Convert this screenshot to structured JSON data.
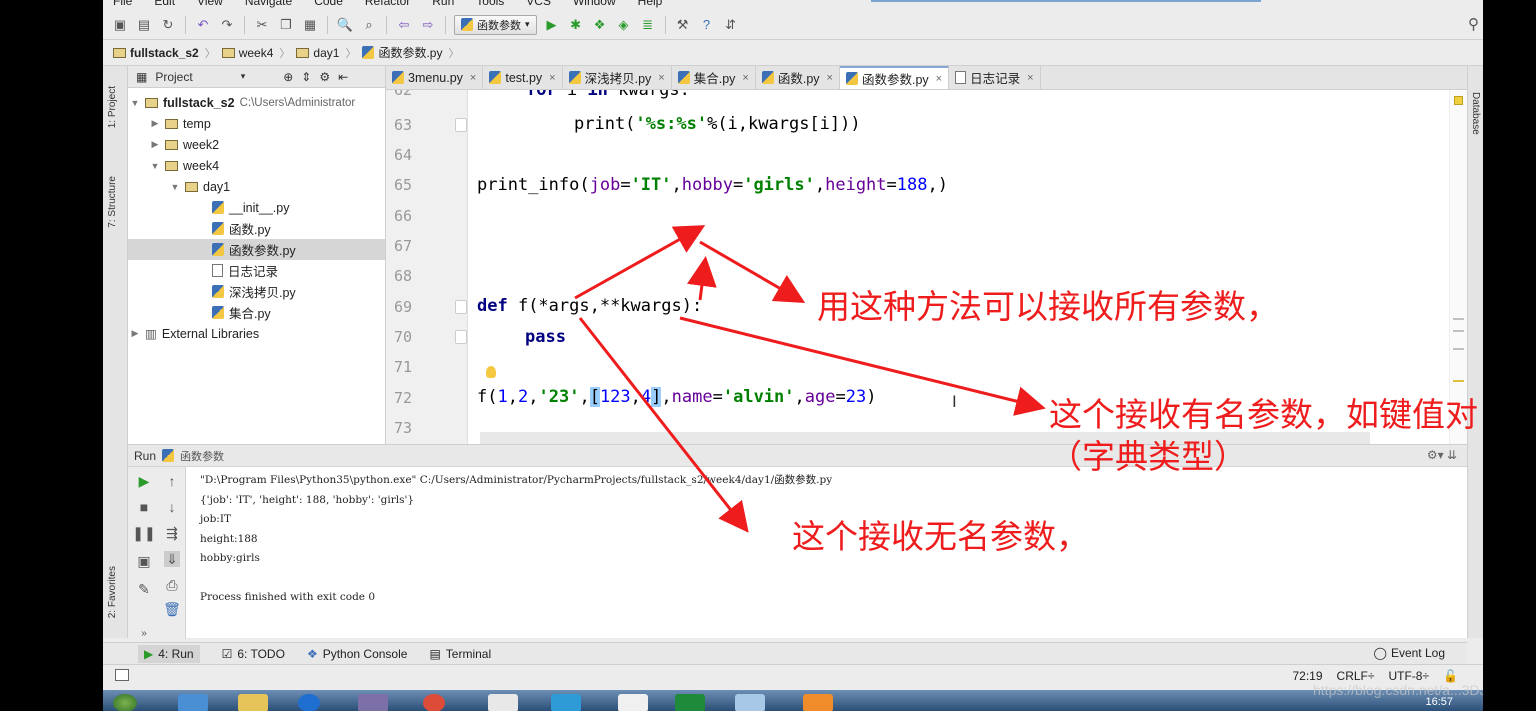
{
  "menu": [
    "File",
    "Edit",
    "View",
    "Navigate",
    "Code",
    "Refactor",
    "Run",
    "Tools",
    "VCS",
    "Window",
    "Help"
  ],
  "toolbar": {
    "run_config": "函数参数"
  },
  "breadcrumb": [
    "fullstack_s2",
    "week4",
    "day1",
    "函数参数.py"
  ],
  "project_panel": {
    "title": "Project",
    "root": "fullstack_s2",
    "root_path": "C:\\Users\\Administrator",
    "items": [
      "temp",
      "week2",
      "week4",
      "day1",
      "__init__.py",
      "函数.py",
      "函数参数.py",
      "日志记录",
      "深浅拷贝.py",
      "集合.py",
      "External Libraries"
    ]
  },
  "side_tabs": {
    "project": "1: Project",
    "structure": "7: Structure",
    "favorites": "2: Favorites",
    "database": "Database"
  },
  "tabs": [
    "3menu.py",
    "test.py",
    "深浅拷贝.py",
    "集合.py",
    "函数.py",
    "函数参数.py",
    "日志记录"
  ],
  "editor": {
    "line_numbers": [
      "62",
      "63",
      "64",
      "65",
      "66",
      "67",
      "68",
      "69",
      "70",
      "71",
      "72",
      "73"
    ]
  },
  "run_panel": {
    "title": "Run",
    "config": "函数参数",
    "output": [
      "\"D:\\Program Files\\Python35\\python.exe\" C:/Users/Administrator/PycharmProjects/fullstack_s2/week4/day1/函数参数.py",
      "{'job': 'IT', 'height': 188, 'hobby': 'girls'}",
      "job:IT",
      "height:188",
      "hobby:girls",
      "",
      "Process finished with exit code 0"
    ]
  },
  "bottom_tools": [
    "4: Run",
    "6: TODO",
    "Python Console",
    "Terminal"
  ],
  "event_log": "Event Log",
  "status": {
    "position": "72:19",
    "line_sep": "CRLF÷",
    "encoding": "UTF-8÷"
  },
  "taskbar": {
    "time": "16:57"
  },
  "annotations": {
    "all_params": "用这种方法可以接收所有参数，",
    "named_params": "这个接收有名参数，如键值对",
    "dict_type": "（字典类型）",
    "unnamed_params": "这个接收无名参数，"
  },
  "watermark": "https://blog.csdn.net/a...3DJS",
  "colors": {
    "annotation": "#ee1c1c",
    "keyword": "#000080",
    "string": "#008000",
    "number": "#0000ff",
    "param": "#660099"
  }
}
